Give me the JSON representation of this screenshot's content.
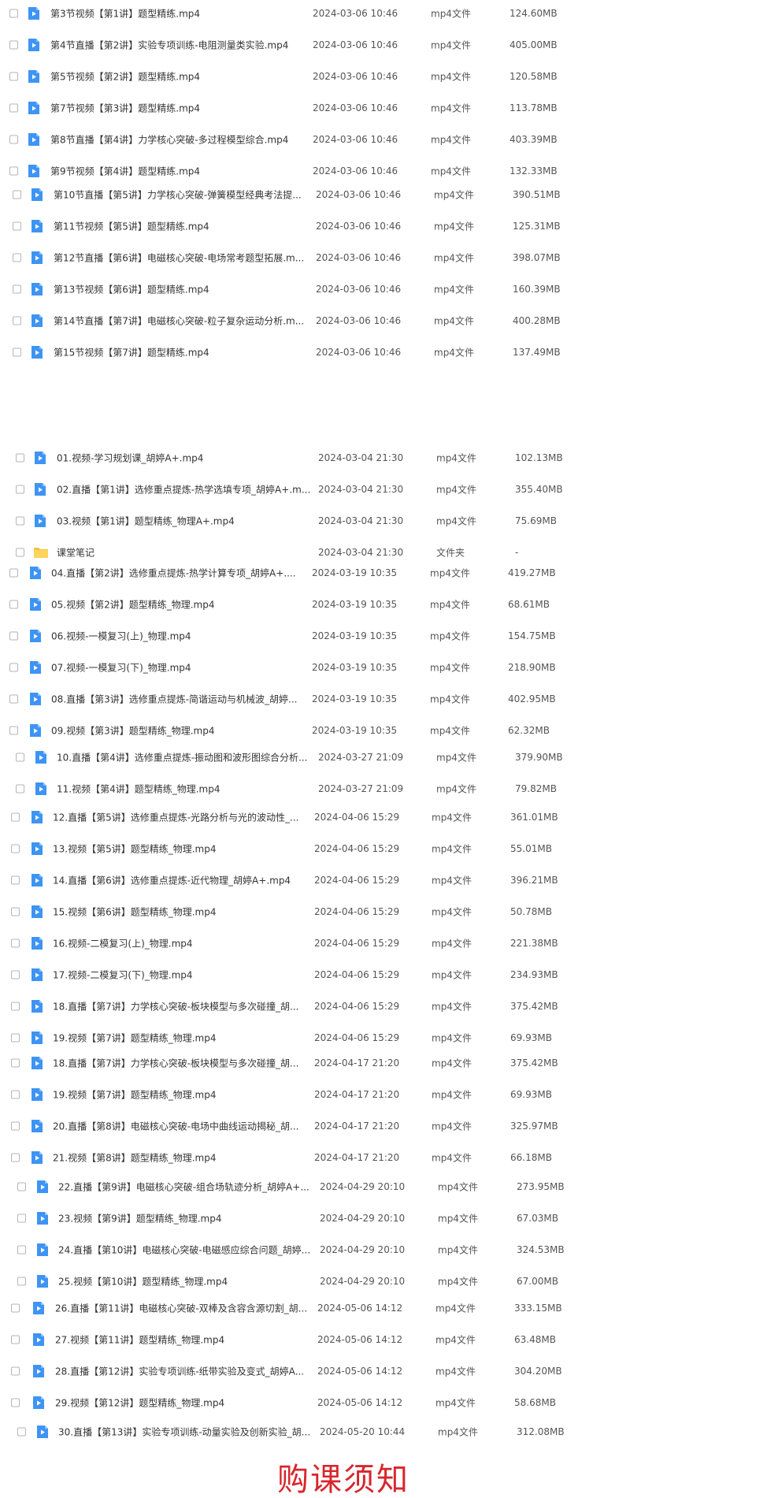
{
  "icons": {
    "video": "video-file-icon",
    "folder": "folder-icon",
    "checkbox": "checkbox-icon"
  },
  "colors": {
    "video_icon": "#3e94f4",
    "folder_icon": "#f7c23a",
    "banner_text": "#d8262c"
  },
  "files": [
    {
      "name": "第3节视频【第1讲】题型精练.mp4",
      "date": "2024-03-06 10:46",
      "type": "mp4文件",
      "size": "124.60MB",
      "icon": "video"
    },
    {
      "name": "第4节直播【第2讲】实验专项训练-电阻测量类实验.mp4",
      "date": "2024-03-06 10:46",
      "type": "mp4文件",
      "size": "405.00MB",
      "icon": "video"
    },
    {
      "name": "第5节视频【第2讲】题型精练.mp4",
      "date": "2024-03-06 10:46",
      "type": "mp4文件",
      "size": "120.58MB",
      "icon": "video"
    },
    {
      "name": "第7节视频【第3讲】题型精练.mp4",
      "date": "2024-03-06 10:46",
      "type": "mp4文件",
      "size": "113.78MB",
      "icon": "video"
    },
    {
      "name": "第8节直播【第4讲】力学核心突破-多过程模型综合.mp4",
      "date": "2024-03-06 10:46",
      "type": "mp4文件",
      "size": "403.39MB",
      "icon": "video"
    },
    {
      "name": "第9节视频【第4讲】题型精练.mp4",
      "date": "2024-03-06 10:46",
      "type": "mp4文件",
      "size": "132.33MB",
      "icon": "video"
    },
    {
      "name": "第10节直播【第5讲】力学核心突破-弹簧模型经典考法提...",
      "date": "2024-03-06 10:46",
      "type": "mp4文件",
      "size": "390.51MB",
      "icon": "video"
    },
    {
      "name": "第11节视频【第5讲】题型精练.mp4",
      "date": "2024-03-06 10:46",
      "type": "mp4文件",
      "size": "125.31MB",
      "icon": "video"
    },
    {
      "name": "第12节直播【第6讲】电磁核心突破-电场常考题型拓展.m...",
      "date": "2024-03-06 10:46",
      "type": "mp4文件",
      "size": "398.07MB",
      "icon": "video"
    },
    {
      "name": "第13节视频【第6讲】题型精练.mp4",
      "date": "2024-03-06 10:46",
      "type": "mp4文件",
      "size": "160.39MB",
      "icon": "video"
    },
    {
      "name": "第14节直播【第7讲】电磁核心突破-粒子复杂运动分析.m...",
      "date": "2024-03-06 10:46",
      "type": "mp4文件",
      "size": "400.28MB",
      "icon": "video"
    },
    {
      "name": "第15节视频【第7讲】题型精练.mp4",
      "date": "2024-03-06 10:46",
      "type": "mp4文件",
      "size": "137.49MB",
      "icon": "video"
    },
    {
      "name": "01.视频-学习规划课_胡婷A+.mp4",
      "date": "2024-03-04 21:30",
      "type": "mp4文件",
      "size": "102.13MB",
      "icon": "video"
    },
    {
      "name": "02.直播【第1讲】选修重点提炼-热学选填专项_胡婷A+.m...",
      "date": "2024-03-04 21:30",
      "type": "mp4文件",
      "size": "355.40MB",
      "icon": "video"
    },
    {
      "name": "03.视频【第1讲】题型精练_物理A+.mp4",
      "date": "2024-03-04 21:30",
      "type": "mp4文件",
      "size": "75.69MB",
      "icon": "video"
    },
    {
      "name": "课堂笔记",
      "date": "2024-03-04 21:30",
      "type": "文件夹",
      "size": "-",
      "icon": "folder"
    },
    {
      "name": "04.直播【第2讲】选修重点提炼-热学计算专项_胡婷A+....",
      "date": "2024-03-19 10:35",
      "type": "mp4文件",
      "size": "419.27MB",
      "icon": "video"
    },
    {
      "name": "05.视频【第2讲】题型精练_物理.mp4",
      "date": "2024-03-19 10:35",
      "type": "mp4文件",
      "size": "68.61MB",
      "icon": "video"
    },
    {
      "name": "06.视频-一模复习(上)_物理.mp4",
      "date": "2024-03-19 10:35",
      "type": "mp4文件",
      "size": "154.75MB",
      "icon": "video"
    },
    {
      "name": "07.视频-一模复习(下)_物理.mp4",
      "date": "2024-03-19 10:35",
      "type": "mp4文件",
      "size": "218.90MB",
      "icon": "video"
    },
    {
      "name": "08.直播【第3讲】选修重点提炼-简谐运动与机械波_胡婷...",
      "date": "2024-03-19 10:35",
      "type": "mp4文件",
      "size": "402.95MB",
      "icon": "video"
    },
    {
      "name": "09.视频【第3讲】题型精练_物理.mp4",
      "date": "2024-03-19 10:35",
      "type": "mp4文件",
      "size": "62.32MB",
      "icon": "video"
    },
    {
      "name": "10.直播【第4讲】选修重点提炼-振动图和波形图综合分析...",
      "date": "2024-03-27 21:09",
      "type": "mp4文件",
      "size": "379.90MB",
      "icon": "video"
    },
    {
      "name": "11.视频【第4讲】题型精练_物理.mp4",
      "date": "2024-03-27 21:09",
      "type": "mp4文件",
      "size": "79.82MB",
      "icon": "video"
    },
    {
      "name": "12.直播【第5讲】选修重点提炼-光路分析与光的波动性_...",
      "date": "2024-04-06 15:29",
      "type": "mp4文件",
      "size": "361.01MB",
      "icon": "video"
    },
    {
      "name": "13.视频【第5讲】题型精练_物理.mp4",
      "date": "2024-04-06 15:29",
      "type": "mp4文件",
      "size": "55.01MB",
      "icon": "video"
    },
    {
      "name": "14.直播【第6讲】选修重点提炼-近代物理_胡婷A+.mp4",
      "date": "2024-04-06 15:29",
      "type": "mp4文件",
      "size": "396.21MB",
      "icon": "video"
    },
    {
      "name": "15.视频【第6讲】题型精练_物理.mp4",
      "date": "2024-04-06 15:29",
      "type": "mp4文件",
      "size": "50.78MB",
      "icon": "video"
    },
    {
      "name": "16.视频-二模复习(上)_物理.mp4",
      "date": "2024-04-06 15:29",
      "type": "mp4文件",
      "size": "221.38MB",
      "icon": "video"
    },
    {
      "name": "17.视频-二模复习(下)_物理.mp4",
      "date": "2024-04-06 15:29",
      "type": "mp4文件",
      "size": "234.93MB",
      "icon": "video"
    },
    {
      "name": "18.直播【第7讲】力学核心突破-板块模型与多次碰撞_胡...",
      "date": "2024-04-06 15:29",
      "type": "mp4文件",
      "size": "375.42MB",
      "icon": "video"
    },
    {
      "name": "19.视频【第7讲】题型精练_物理.mp4",
      "date": "2024-04-06 15:29",
      "type": "mp4文件",
      "size": "69.93MB",
      "icon": "video"
    },
    {
      "name": "18.直播【第7讲】力学核心突破-板块模型与多次碰撞_胡...",
      "date": "2024-04-17 21:20",
      "type": "mp4文件",
      "size": "375.42MB",
      "icon": "video"
    },
    {
      "name": "19.视频【第7讲】题型精练_物理.mp4",
      "date": "2024-04-17 21:20",
      "type": "mp4文件",
      "size": "69.93MB",
      "icon": "video"
    },
    {
      "name": "20.直播【第8讲】电磁核心突破-电场中曲线运动揭秘_胡...",
      "date": "2024-04-17 21:20",
      "type": "mp4文件",
      "size": "325.97MB",
      "icon": "video"
    },
    {
      "name": "21.视频【第8讲】题型精练_物理.mp4",
      "date": "2024-04-17 21:20",
      "type": "mp4文件",
      "size": "66.18MB",
      "icon": "video"
    },
    {
      "name": "22.直播【第9讲】电磁核心突破-组合场轨迹分析_胡婷A+...",
      "date": "2024-04-29 20:10",
      "type": "mp4文件",
      "size": "273.95MB",
      "icon": "video"
    },
    {
      "name": "23.视频【第9讲】题型精练_物理.mp4",
      "date": "2024-04-29 20:10",
      "type": "mp4文件",
      "size": "67.03MB",
      "icon": "video"
    },
    {
      "name": "24.直播【第10讲】电磁核心突破-电磁感应综合问题_胡婷...",
      "date": "2024-04-29 20:10",
      "type": "mp4文件",
      "size": "324.53MB",
      "icon": "video"
    },
    {
      "name": "25.视频【第10讲】题型精练_物理.mp4",
      "date": "2024-04-29 20:10",
      "type": "mp4文件",
      "size": "67.00MB",
      "icon": "video"
    },
    {
      "name": "26.直播【第11讲】电磁核心突破-双棒及含容含源切割_胡...",
      "date": "2024-05-06 14:12",
      "type": "mp4文件",
      "size": "333.15MB",
      "icon": "video"
    },
    {
      "name": "27.视频【第11讲】题型精练_物理.mp4",
      "date": "2024-05-06 14:12",
      "type": "mp4文件",
      "size": "63.48MB",
      "icon": "video"
    },
    {
      "name": "28.直播【第12讲】实验专项训练-纸带实验及变式_胡婷A...",
      "date": "2024-05-06 14:12",
      "type": "mp4文件",
      "size": "304.20MB",
      "icon": "video"
    },
    {
      "name": "29.视频【第12讲】题型精练_物理.mp4",
      "date": "2024-05-06 14:12",
      "type": "mp4文件",
      "size": "58.68MB",
      "icon": "video"
    },
    {
      "name": "30.直播【第13讲】实验专项训练-动量实验及创新实验_胡...",
      "date": "2024-05-20 10:44",
      "type": "mp4文件",
      "size": "312.08MB",
      "icon": "video"
    }
  ],
  "banner": {
    "text": "购课须知"
  }
}
